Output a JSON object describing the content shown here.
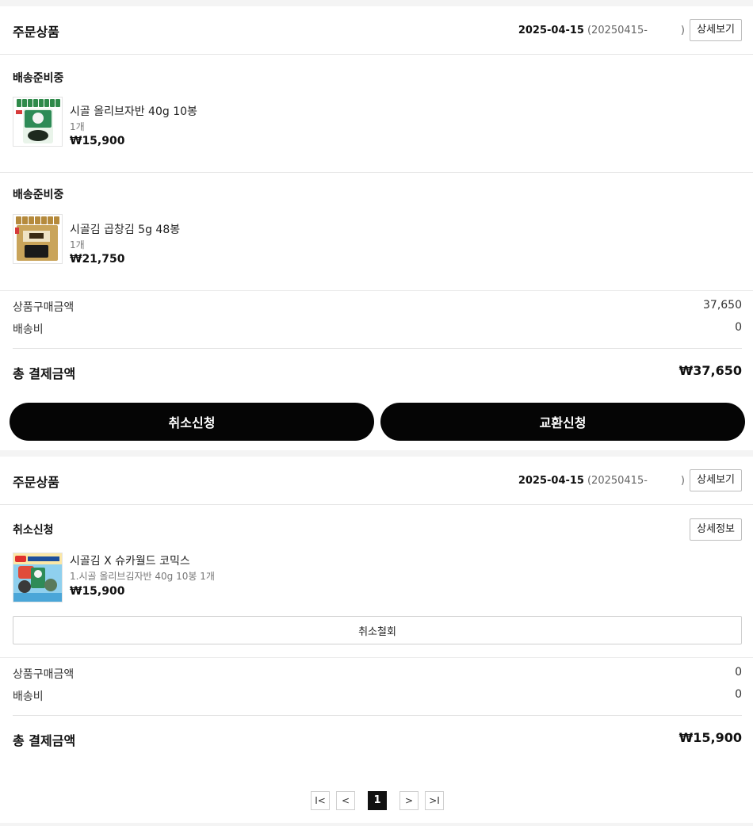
{
  "orders": [
    {
      "title": "주문상품",
      "date": "2025-04-15",
      "order_no": "(20250415-",
      "order_no_close": ")",
      "detail_btn": "상세보기",
      "items": [
        {
          "status": "배송준비중",
          "name": "시골 올리브자반 40g 10봉",
          "option": "1개",
          "price": "₩15,900",
          "thumb_icon": "seaweed-pack-green-icon"
        },
        {
          "status": "배송준비중",
          "name": "시골김 곱창김 5g 48봉",
          "option": "1개",
          "price": "₩21,750",
          "thumb_icon": "seaweed-pack-gold-icon"
        }
      ],
      "summary": {
        "product_label": "상품구매금액",
        "product_value": "37,650",
        "shipping_label": "배송비",
        "shipping_value": "0",
        "total_label": "총 결제금액",
        "total_value": "₩37,650"
      },
      "actions": {
        "cancel": "취소신청",
        "exchange": "교환신청"
      }
    },
    {
      "title": "주문상품",
      "date": "2025-04-15",
      "order_no": "(20250415-",
      "order_no_close": ")",
      "detail_btn": "상세보기",
      "items": [
        {
          "status": "취소신청",
          "detail_info_btn": "상세정보",
          "name": "시골김 X 슈카월드 코믹스",
          "option": "1.시골 올리브김자반 40g 10봉 1개",
          "price": "₩15,900",
          "thumb_icon": "comics-bundle-icon",
          "withdraw_btn": "취소철회"
        }
      ],
      "summary": {
        "product_label": "상품구매금액",
        "product_value": "0",
        "shipping_label": "배송비",
        "shipping_value": "0",
        "total_label": "총 결제금액",
        "total_value": "₩15,900"
      }
    }
  ],
  "pagination": {
    "first": "I<",
    "prev": "<",
    "current": "1",
    "next": ">",
    "last": ">I"
  },
  "colors": {
    "primary_button": "#050505",
    "page_bg": "#f4f4f4"
  }
}
